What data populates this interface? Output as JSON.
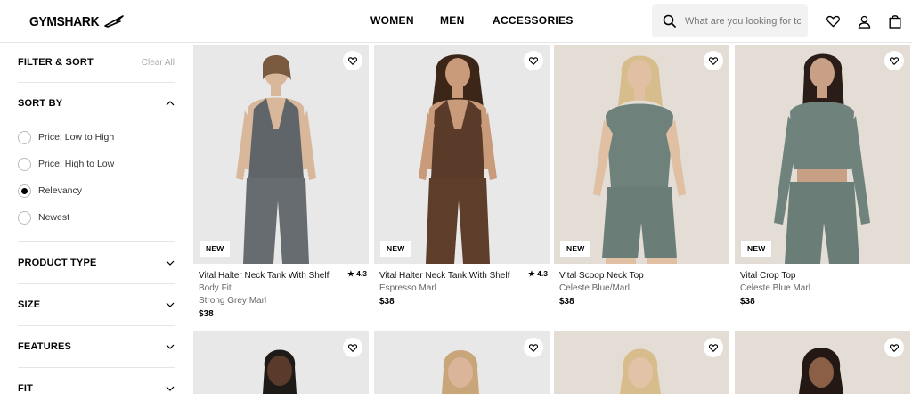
{
  "brand": {
    "name": "GYMSHARK"
  },
  "nav": {
    "items": [
      "WOMEN",
      "MEN",
      "ACCESSORIES"
    ]
  },
  "search": {
    "placeholder": "What are you looking for to..."
  },
  "sidebar": {
    "filter_title": "FILTER & SORT",
    "clear_all": "Clear All",
    "sort_by": {
      "title": "SORT BY",
      "options": [
        "Price: Low to High",
        "Price: High to Low",
        "Relevancy",
        "Newest"
      ],
      "selected": "Relevancy"
    },
    "sections": [
      "PRODUCT TYPE",
      "SIZE",
      "FEATURES",
      "FIT"
    ]
  },
  "products": [
    {
      "badge": "NEW",
      "name": "Vital Halter Neck Tank With Shelf",
      "subtitle": "Body Fit",
      "color": "Strong Grey Marl",
      "price": "$38",
      "rating": "4.3"
    },
    {
      "badge": "NEW",
      "name": "Vital Halter Neck Tank With Shelf",
      "subtitle": "",
      "color": "Espresso Marl",
      "price": "$38",
      "rating": "4.3"
    },
    {
      "badge": "NEW",
      "name": "Vital Scoop Neck Top",
      "subtitle": "",
      "color": "Celeste Blue/Marl",
      "price": "$38",
      "rating": ""
    },
    {
      "badge": "NEW",
      "name": "Vital Crop Top",
      "subtitle": "",
      "color": "Celeste Blue Marl",
      "price": "$38",
      "rating": ""
    }
  ],
  "colors": {
    "img_bg": "#e8e8e8",
    "img_bg_warm": "#e3ddd5",
    "border": "#e6e6e6"
  },
  "icons": [
    "search-icon",
    "heart-icon",
    "user-icon",
    "bag-icon",
    "chevron-up-icon",
    "chevron-down-icon",
    "star-icon"
  ]
}
